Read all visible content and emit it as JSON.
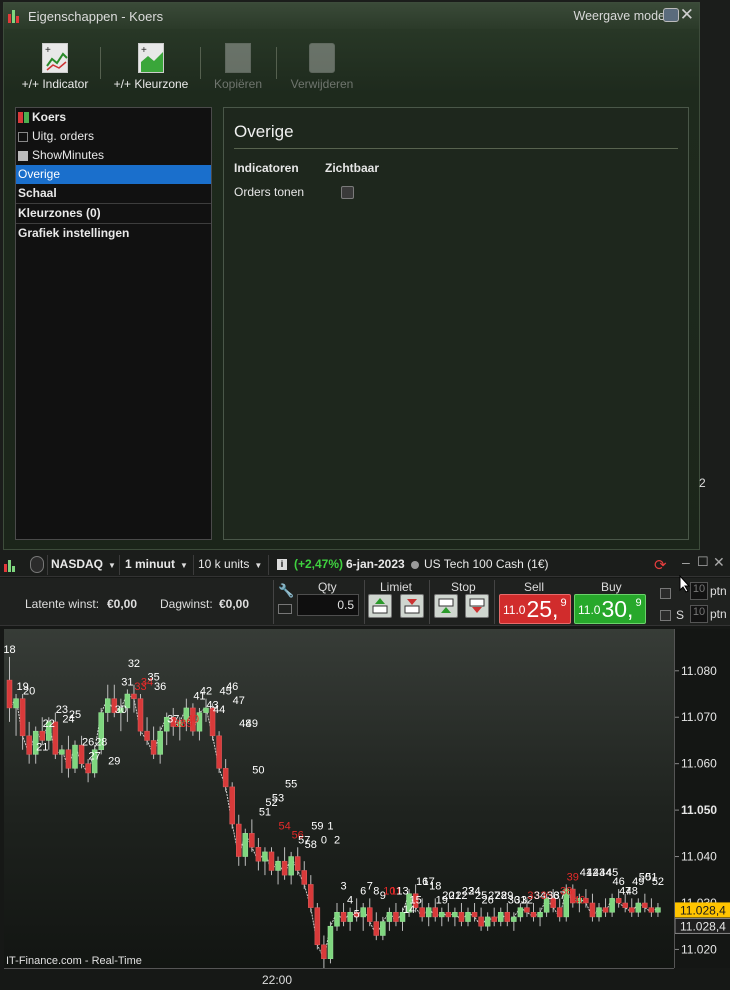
{
  "dialog": {
    "title": "Eigenschappen - Koers",
    "view_mode": "Weergave mode",
    "close_glyph": "✕",
    "toolbar": {
      "add_indicator": "+/+ Indicator",
      "add_color_zone": "+/+ Kleurzone",
      "copy": "Kopiëren",
      "delete": "Verwijderen"
    },
    "tree": [
      {
        "label": "Koers"
      },
      {
        "label": "Uitg. orders"
      },
      {
        "label": "ShowMinutes"
      },
      {
        "label": "Overige"
      },
      {
        "label": "Schaal"
      },
      {
        "label": "Kleurzones (0)"
      },
      {
        "label": "Grafiek instellingen"
      }
    ],
    "panel": {
      "title": "Overige",
      "col_indicators": "Indicatoren",
      "col_visible": "Zichtbaar",
      "row_label": "Orders tonen",
      "row_checked": false
    }
  },
  "chart_window": {
    "market": "NASDAQ",
    "timeframe": "1 minuut",
    "units": "10 k units",
    "change": "(+2,47%)",
    "date": "6-jan-2023",
    "instrument": "US Tech 100 Cash (1€)",
    "win_controls": [
      "–",
      "☐",
      "✕"
    ],
    "latent_label": "Latente winst:",
    "latent_value": "€0,00",
    "day_label": "Dagwinst:",
    "day_value": "€0,00",
    "qty_label": "Qty",
    "qty_value": "0.5",
    "limit_label": "Limiet",
    "stop_label": "Stop",
    "sell_label": "Sell",
    "buy_label": "Buy",
    "sell_small": "11.0",
    "sell_big": "25,",
    "sell_sup": "9",
    "buy_small": "11.0",
    "buy_big": "30,",
    "buy_sup": "9",
    "ptn_label": "ptn",
    "ptn_value": "10",
    "s_label": "S",
    "page_edge_text": "2",
    "watermark": "IT-Finance.com - Real-Time",
    "time_label": "22:00",
    "colors": {
      "up": "#7fd67f",
      "down": "#d83a3a",
      "accent": "#1a6fcc",
      "last_price": "#ffc400"
    }
  },
  "chart_data": {
    "type": "candlestick",
    "y_ticks": [
      "11.080",
      "11.070",
      "11.060",
      "11.050",
      "11.040",
      "11.030",
      "11.020"
    ],
    "ylim": [
      11.016,
      11.089
    ],
    "last_price": "11.028,4",
    "close_marker": "11.028,4",
    "x_label": "22:00",
    "candles": [
      [
        11.078,
        11.083,
        11.069,
        11.072
      ],
      [
        11.072,
        11.075,
        11.066,
        11.074
      ],
      [
        11.074,
        11.075,
        11.063,
        11.066
      ],
      [
        11.066,
        11.069,
        11.06,
        11.062
      ],
      [
        11.062,
        11.068,
        11.06,
        11.067
      ],
      [
        11.067,
        11.07,
        11.064,
        11.065
      ],
      [
        11.065,
        11.07,
        11.063,
        11.069
      ],
      [
        11.069,
        11.071,
        11.061,
        11.062
      ],
      [
        11.062,
        11.064,
        11.058,
        11.063
      ],
      [
        11.063,
        11.066,
        11.057,
        11.059
      ],
      [
        11.059,
        11.065,
        11.058,
        11.064
      ],
      [
        11.064,
        11.066,
        11.059,
        11.06
      ],
      [
        11.06,
        11.061,
        11.056,
        11.058
      ],
      [
        11.058,
        11.064,
        11.057,
        11.063
      ],
      [
        11.063,
        11.072,
        11.062,
        11.071
      ],
      [
        11.071,
        11.077,
        11.069,
        11.074
      ],
      [
        11.074,
        11.077,
        11.07,
        11.071
      ],
      [
        11.071,
        11.074,
        11.067,
        11.072
      ],
      [
        11.072,
        11.076,
        11.069,
        11.075
      ],
      [
        11.075,
        11.077,
        11.071,
        11.074
      ],
      [
        11.074,
        11.075,
        11.066,
        11.067
      ],
      [
        11.067,
        11.07,
        11.064,
        11.065
      ],
      [
        11.065,
        11.068,
        11.061,
        11.062
      ],
      [
        11.062,
        11.068,
        11.06,
        11.067
      ],
      [
        11.067,
        11.071,
        11.064,
        11.07
      ],
      [
        11.07,
        11.072,
        11.066,
        11.068
      ],
      [
        11.068,
        11.07,
        11.065,
        11.069
      ],
      [
        11.069,
        11.074,
        11.067,
        11.072
      ],
      [
        11.072,
        11.073,
        11.066,
        11.067
      ],
      [
        11.067,
        11.072,
        11.065,
        11.071
      ],
      [
        11.071,
        11.074,
        11.069,
        11.072
      ],
      [
        11.072,
        11.073,
        11.065,
        11.066
      ],
      [
        11.066,
        11.067,
        11.058,
        11.059
      ],
      [
        11.059,
        11.061,
        11.054,
        11.055
      ],
      [
        11.055,
        11.056,
        11.046,
        11.047
      ],
      [
        11.047,
        11.049,
        11.038,
        11.04
      ],
      [
        11.04,
        11.046,
        11.038,
        11.045
      ],
      [
        11.045,
        11.048,
        11.041,
        11.042
      ],
      [
        11.042,
        11.044,
        11.037,
        11.039
      ],
      [
        11.039,
        11.042,
        11.036,
        11.041
      ],
      [
        11.041,
        11.042,
        11.036,
        11.037
      ],
      [
        11.037,
        11.04,
        11.034,
        11.039
      ],
      [
        11.039,
        11.042,
        11.035,
        11.036
      ],
      [
        11.036,
        11.041,
        11.034,
        11.04
      ],
      [
        11.04,
        11.042,
        11.036,
        11.037
      ],
      [
        11.037,
        11.039,
        11.033,
        11.034
      ],
      [
        11.034,
        11.036,
        11.028,
        11.029
      ],
      [
        11.029,
        11.03,
        11.02,
        11.021
      ],
      [
        11.021,
        11.023,
        11.016,
        11.018
      ],
      [
        11.018,
        11.026,
        11.017,
        11.025
      ],
      [
        11.025,
        11.03,
        11.024,
        11.028
      ],
      [
        11.028,
        11.03,
        11.025,
        11.026
      ],
      [
        11.026,
        11.029,
        11.024,
        11.028
      ],
      [
        11.028,
        11.031,
        11.026,
        11.027
      ],
      [
        11.027,
        11.03,
        11.024,
        11.029
      ],
      [
        11.029,
        11.031,
        11.025,
        11.026
      ],
      [
        11.026,
        11.028,
        11.022,
        11.023
      ],
      [
        11.023,
        11.027,
        11.022,
        11.026
      ],
      [
        11.026,
        11.029,
        11.024,
        11.028
      ],
      [
        11.028,
        11.03,
        11.025,
        11.026
      ],
      [
        11.026,
        11.029,
        11.024,
        11.028
      ],
      [
        11.028,
        11.033,
        11.027,
        11.032
      ],
      [
        11.032,
        11.034,
        11.028,
        11.029
      ],
      [
        11.029,
        11.031,
        11.026,
        11.027
      ],
      [
        11.027,
        11.03,
        11.025,
        11.029
      ],
      [
        11.029,
        11.031,
        11.026,
        11.027
      ],
      [
        11.027,
        11.029,
        11.025,
        11.028
      ],
      [
        11.028,
        11.03,
        11.026,
        11.027
      ],
      [
        11.027,
        11.029,
        11.025,
        11.028
      ],
      [
        11.028,
        11.03,
        11.025,
        11.026
      ],
      [
        11.026,
        11.029,
        11.025,
        11.028
      ],
      [
        11.028,
        11.03,
        11.026,
        11.027
      ],
      [
        11.027,
        11.029,
        11.024,
        11.025
      ],
      [
        11.025,
        11.028,
        11.024,
        11.027
      ],
      [
        11.027,
        11.029,
        11.025,
        11.026
      ],
      [
        11.026,
        11.029,
        11.025,
        11.028
      ],
      [
        11.028,
        11.03,
        11.025,
        11.026
      ],
      [
        11.026,
        11.028,
        11.024,
        11.027
      ],
      [
        11.027,
        11.03,
        11.026,
        11.029
      ],
      [
        11.029,
        11.031,
        11.027,
        11.028
      ],
      [
        11.028,
        11.03,
        11.026,
        11.027
      ],
      [
        11.027,
        11.029,
        11.025,
        11.028
      ],
      [
        11.028,
        11.032,
        11.027,
        11.031
      ],
      [
        11.031,
        11.033,
        11.028,
        11.029
      ],
      [
        11.029,
        11.031,
        11.026,
        11.027
      ],
      [
        11.027,
        11.034,
        11.026,
        11.033
      ],
      [
        11.033,
        11.034,
        11.029,
        11.03
      ],
      [
        11.03,
        11.032,
        11.028,
        11.031
      ],
      [
        11.031,
        11.033,
        11.029,
        11.03
      ],
      [
        11.03,
        11.032,
        11.026,
        11.027
      ],
      [
        11.027,
        11.03,
        11.026,
        11.029
      ],
      [
        11.029,
        11.031,
        11.027,
        11.028
      ],
      [
        11.028,
        11.032,
        11.027,
        11.031
      ],
      [
        11.031,
        11.033,
        11.029,
        11.03
      ],
      [
        11.03,
        11.032,
        11.028,
        11.029
      ],
      [
        11.029,
        11.031,
        11.027,
        11.028
      ],
      [
        11.028,
        11.031,
        11.027,
        11.03
      ],
      [
        11.03,
        11.032,
        11.028,
        11.029
      ],
      [
        11.029,
        11.031,
        11.027,
        11.028
      ],
      [
        11.028,
        11.03,
        11.027,
        11.029
      ]
    ],
    "bar_labels": [
      {
        "i": 0,
        "t": "18",
        "c": "w",
        "y": 11.083
      },
      {
        "i": 2,
        "t": "19",
        "c": "w",
        "y": 11.075
      },
      {
        "i": 3,
        "t": "20",
        "c": "w",
        "y": 11.074
      },
      {
        "i": 5,
        "t": "21",
        "c": "w",
        "y": 11.062
      },
      {
        "i": 6,
        "t": "22",
        "c": "w",
        "y": 11.067
      },
      {
        "i": 8,
        "t": "23",
        "c": "w",
        "y": 11.07
      },
      {
        "i": 9,
        "t": "24",
        "c": "w",
        "y": 11.068
      },
      {
        "i": 10,
        "t": "25",
        "c": "w",
        "y": 11.069
      },
      {
        "i": 12,
        "t": "26",
        "c": "w",
        "y": 11.063
      },
      {
        "i": 13,
        "t": "27",
        "c": "w",
        "y": 11.06
      },
      {
        "i": 14,
        "t": "28",
        "c": "w",
        "y": 11.063
      },
      {
        "i": 16,
        "t": "29",
        "c": "w",
        "y": 11.059
      },
      {
        "i": 17,
        "t": "30",
        "c": "w",
        "y": 11.07
      },
      {
        "i": 18,
        "t": "31",
        "c": "w",
        "y": 11.076
      },
      {
        "i": 19,
        "t": "32",
        "c": "w",
        "y": 11.08
      },
      {
        "i": 20,
        "t": "33",
        "c": "r",
        "y": 11.075
      },
      {
        "i": 21,
        "t": "34",
        "c": "r",
        "y": 11.076
      },
      {
        "i": 22,
        "t": "35",
        "c": "w",
        "y": 11.077
      },
      {
        "i": 23,
        "t": "36",
        "c": "w",
        "y": 11.075
      },
      {
        "i": 25,
        "t": "37",
        "c": "w",
        "y": 11.068
      },
      {
        "i": 26,
        "t": "38",
        "c": "r",
        "y": 11.067
      },
      {
        "i": 27,
        "t": "39",
        "c": "r",
        "y": 11.067
      },
      {
        "i": 28,
        "t": "40",
        "c": "r",
        "y": 11.068
      },
      {
        "i": 29,
        "t": "41",
        "c": "w",
        "y": 11.073
      },
      {
        "i": 30,
        "t": "42",
        "c": "w",
        "y": 11.074
      },
      {
        "i": 31,
        "t": "43",
        "c": "w",
        "y": 11.071
      },
      {
        "i": 32,
        "t": "44",
        "c": "w",
        "y": 11.07
      },
      {
        "i": 33,
        "t": "45",
        "c": "w",
        "y": 11.074
      },
      {
        "i": 34,
        "t": "46",
        "c": "w",
        "y": 11.075
      },
      {
        "i": 35,
        "t": "47",
        "c": "w",
        "y": 11.072
      },
      {
        "i": 36,
        "t": "48",
        "c": "w",
        "y": 11.067
      },
      {
        "i": 37,
        "t": "49",
        "c": "w",
        "y": 11.067
      },
      {
        "i": 38,
        "t": "50",
        "c": "w",
        "y": 11.057
      },
      {
        "i": 39,
        "t": "51",
        "c": "w",
        "y": 11.048
      },
      {
        "i": 40,
        "t": "52",
        "c": "w",
        "y": 11.05
      },
      {
        "i": 41,
        "t": "53",
        "c": "w",
        "y": 11.051
      },
      {
        "i": 42,
        "t": "54",
        "c": "r",
        "y": 11.045
      },
      {
        "i": 43,
        "t": "55",
        "c": "w",
        "y": 11.054
      },
      {
        "i": 44,
        "t": "56",
        "c": "r",
        "y": 11.043
      },
      {
        "i": 45,
        "t": "57",
        "c": "w",
        "y": 11.042
      },
      {
        "i": 46,
        "t": "58",
        "c": "w",
        "y": 11.041
      },
      {
        "i": 47,
        "t": "59",
        "c": "w",
        "y": 11.045
      },
      {
        "i": 48,
        "t": "0",
        "c": "w",
        "y": 11.042
      },
      {
        "i": 49,
        "t": "1",
        "c": "w",
        "y": 11.045
      },
      {
        "i": 50,
        "t": "2",
        "c": "w",
        "y": 11.042
      },
      {
        "i": 51,
        "t": "3",
        "c": "w",
        "y": 11.032
      },
      {
        "i": 52,
        "t": "4",
        "c": "w",
        "y": 11.029
      },
      {
        "i": 53,
        "t": "5",
        "c": "w",
        "y": 11.026
      },
      {
        "i": 54,
        "t": "6",
        "c": "w",
        "y": 11.031
      },
      {
        "i": 55,
        "t": "7",
        "c": "w",
        "y": 11.032
      },
      {
        "i": 56,
        "t": "8",
        "c": "w",
        "y": 11.031
      },
      {
        "i": 57,
        "t": "9",
        "c": "w",
        "y": 11.03
      },
      {
        "i": 58,
        "t": "10",
        "c": "r",
        "y": 11.031
      },
      {
        "i": 59,
        "t": "11",
        "c": "r",
        "y": 11.031
      },
      {
        "i": 60,
        "t": "13",
        "c": "w",
        "y": 11.031
      },
      {
        "i": 61,
        "t": "14",
        "c": "w",
        "y": 11.027
      },
      {
        "i": 62,
        "t": "15",
        "c": "w",
        "y": 11.029
      },
      {
        "i": 63,
        "t": "16",
        "c": "w",
        "y": 11.033
      },
      {
        "i": 64,
        "t": "17",
        "c": "w",
        "y": 11.033
      },
      {
        "i": 65,
        "t": "18",
        "c": "w",
        "y": 11.032
      },
      {
        "i": 66,
        "t": "19",
        "c": "w",
        "y": 11.029
      },
      {
        "i": 67,
        "t": "20",
        "c": "w",
        "y": 11.03
      },
      {
        "i": 68,
        "t": "21",
        "c": "w",
        "y": 11.03
      },
      {
        "i": 69,
        "t": "22",
        "c": "w",
        "y": 11.03
      },
      {
        "i": 70,
        "t": "23",
        "c": "w",
        "y": 11.031
      },
      {
        "i": 71,
        "t": "24",
        "c": "w",
        "y": 11.031
      },
      {
        "i": 72,
        "t": "25",
        "c": "w",
        "y": 11.03
      },
      {
        "i": 73,
        "t": "26",
        "c": "w",
        "y": 11.029
      },
      {
        "i": 74,
        "t": "27",
        "c": "w",
        "y": 11.03
      },
      {
        "i": 75,
        "t": "28",
        "c": "w",
        "y": 11.03
      },
      {
        "i": 76,
        "t": "29",
        "c": "w",
        "y": 11.03
      },
      {
        "i": 77,
        "t": "30",
        "c": "w",
        "y": 11.029
      },
      {
        "i": 78,
        "t": "31",
        "c": "w",
        "y": 11.029
      },
      {
        "i": 79,
        "t": "32",
        "c": "w",
        "y": 11.029
      },
      {
        "i": 80,
        "t": "33",
        "c": "r",
        "y": 11.03
      },
      {
        "i": 81,
        "t": "34",
        "c": "w",
        "y": 11.03
      },
      {
        "i": 82,
        "t": "35",
        "c": "r",
        "y": 11.03
      },
      {
        "i": 83,
        "t": "36",
        "c": "w",
        "y": 11.03
      },
      {
        "i": 84,
        "t": "37",
        "c": "w",
        "y": 11.03
      },
      {
        "i": 85,
        "t": "38",
        "c": "r",
        "y": 11.031
      },
      {
        "i": 86,
        "t": "39",
        "c": "r",
        "y": 11.034
      },
      {
        "i": 87,
        "t": "40",
        "c": "r",
        "y": 11.029
      },
      {
        "i": 88,
        "t": "41",
        "c": "w",
        "y": 11.035
      },
      {
        "i": 89,
        "t": "42",
        "c": "w",
        "y": 11.035
      },
      {
        "i": 90,
        "t": "43",
        "c": "w",
        "y": 11.035
      },
      {
        "i": 91,
        "t": "44",
        "c": "w",
        "y": 11.035
      },
      {
        "i": 92,
        "t": "45",
        "c": "w",
        "y": 11.035
      },
      {
        "i": 93,
        "t": "46",
        "c": "w",
        "y": 11.033
      },
      {
        "i": 94,
        "t": "47",
        "c": "w",
        "y": 11.031
      },
      {
        "i": 95,
        "t": "48",
        "c": "w",
        "y": 11.031
      },
      {
        "i": 96,
        "t": "49",
        "c": "w",
        "y": 11.033
      },
      {
        "i": 97,
        "t": "50",
        "c": "w",
        "y": 11.034
      },
      {
        "i": 98,
        "t": "51",
        "c": "w",
        "y": 11.034
      },
      {
        "i": 99,
        "t": "52",
        "c": "w",
        "y": 11.033
      }
    ]
  }
}
